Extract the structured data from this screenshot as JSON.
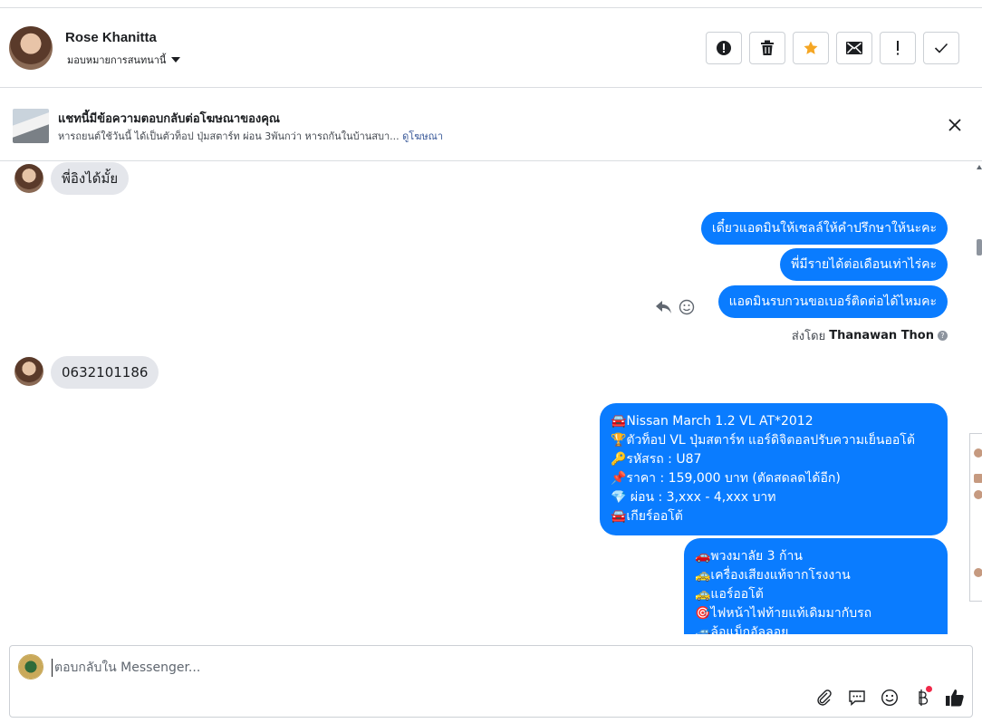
{
  "header": {
    "contact_name": "Rose Khanitta",
    "assign_label": "มอบหมายการสนทนานี้",
    "actions": [
      {
        "icon": "alert-circle-icon",
        "name": "mark-spam-button"
      },
      {
        "icon": "trash-icon",
        "name": "delete-button"
      },
      {
        "icon": "star-icon",
        "name": "star-button"
      },
      {
        "icon": "envelope-icon",
        "name": "mark-unread-button"
      },
      {
        "icon": "exclamation-icon",
        "name": "follow-up-button"
      },
      {
        "icon": "check-icon",
        "name": "mark-done-button"
      }
    ]
  },
  "ad_banner": {
    "title": "แชทนี้มีข้อความตอบกลับต่อโฆษณาของคุณ",
    "description": "หารถยนต์ใช้วันนี้ ได้เป็นตัวท็อป ปุ่มสตาร์ท ผ่อน 3พันกว่า หารถกันในบ้านสบา...",
    "link": "ดูโฆษณา"
  },
  "messages": {
    "incoming_1": "พี่อิงได้มั้ย",
    "outgoing_1": "เดี๋ยวแอดมินให้เซลล์ให้คำปรึกษาให้นะคะ",
    "outgoing_2": "พี่มีรายได้ต่อเดือนเท่าไร่คะ",
    "outgoing_3": "แอดมินรบกวนขอเบอร์ติดต่อได้ไหมคะ",
    "sent_by_label": "ส่งโดย",
    "sent_by_name": "Thanawan Thon",
    "incoming_2": "0632101186",
    "card_1": [
      "🚘Nissan March 1.2 VL AT*2012",
      "🏆ตัวท็อป VL ปุ่มสตาร์ท แอร์ดิจิตอลปรับความเย็นออโต้",
      "🔑รหัสรถ : U87",
      "📌ราคา : 159,000 บาท  (ตัดสดลดได้อีก)",
      "💎 ผ่อน : 3,xxx - 4,xxx บาท",
      "🚘เกียร์ออโต้"
    ],
    "card_2": [
      "🚗พวงมาลัย 3 ก้าน",
      "🚕เครื่องเสียงแท้จากโรงงาน",
      "🚕แอร์ออโต้",
      "🎯ไฟหน้าไฟท้ายแท้เดิมมากับรถ",
      "🚙ล้อแม็กอัลลอย"
    ]
  },
  "composer": {
    "placeholder": "ตอบกลับใน Messenger..."
  },
  "colors": {
    "outgoing_bubble": "#0a7cff",
    "incoming_bubble": "#e4e6eb",
    "star": "#f5a623",
    "link": "#385898"
  }
}
